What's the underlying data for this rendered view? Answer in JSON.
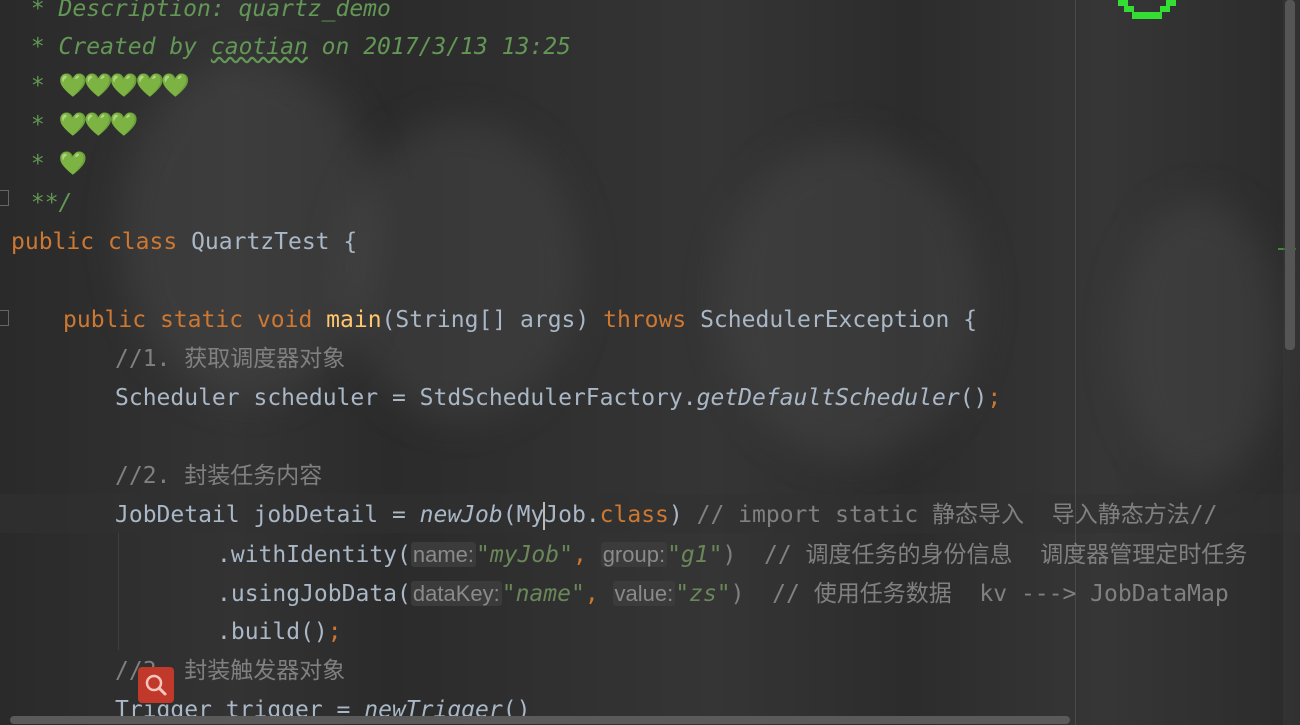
{
  "code": {
    "doc_description": " * Description: quartz_demo",
    "doc_created_prefix": " * Created by ",
    "doc_author": "caotian",
    "doc_created_suffix": " on 2017/3/13 13:25",
    "doc_star": " * ",
    "doc_hearts_5": "💚💚💚💚💚",
    "doc_hearts_3": "💚💚💚",
    "doc_hearts_1": "💚",
    "doc_end": " **/",
    "kw_public": "public",
    "kw_class": "class",
    "class_name": "QuartzTest",
    "brace_open": "{",
    "kw_static": "static",
    "kw_void": "void",
    "method_main": "main",
    "main_params": "(String[] args)",
    "kw_throws": "throws",
    "exception_type": "SchedulerException",
    "comment_1": "//1. 获取调度器对象",
    "scheduler_decl": "Scheduler scheduler = StdSchedulerFactory.",
    "get_default_scheduler": "getDefaultScheduler",
    "call_parens": "()",
    "semicolon": ";",
    "comment_2": "//2. 封装任务内容",
    "jobdetail_decl": "JobDetail jobDetail = ",
    "new_job": "newJob",
    "myjob_open": "(My",
    "myjob_rest": "Job.",
    "kw_class_lit": "class",
    "close_paren": ")",
    "comment_import": " // import static 静态导入  导入静态方法//",
    "with_identity": ".withIdentity(",
    "hint_name": "name:",
    "str_myjob": "\"myJob\"",
    "comma": ",",
    "hint_group": "group:",
    "str_g1": "\"g1\"",
    "comment_identity": ")  // 调度任务的身份信息  调度器管理定时任务",
    "using_job_data": ".usingJobData(",
    "hint_datakey": "dataKey:",
    "str_name": "\"name\"",
    "hint_value": "value:",
    "str_zs": "\"zs\"",
    "comment_jobdata": ")  // 使用任务数据  kv ---> JobDataMap",
    "build_call": ".build()",
    "comment_3": "//3. 封装触发器对象",
    "trigger_decl": "Trigger trigger = ",
    "new_trigger": "newTrigger"
  },
  "icons": {
    "search": "magnifier-icon",
    "status": "green-pixel-icon"
  },
  "colors": {
    "keyword": "#cc7832",
    "method": "#ffc66d",
    "doc_comment": "#629755",
    "comment": "#808080",
    "string": "#6a8759",
    "text": "#a9b7c6",
    "search_button": "#c0392b"
  }
}
